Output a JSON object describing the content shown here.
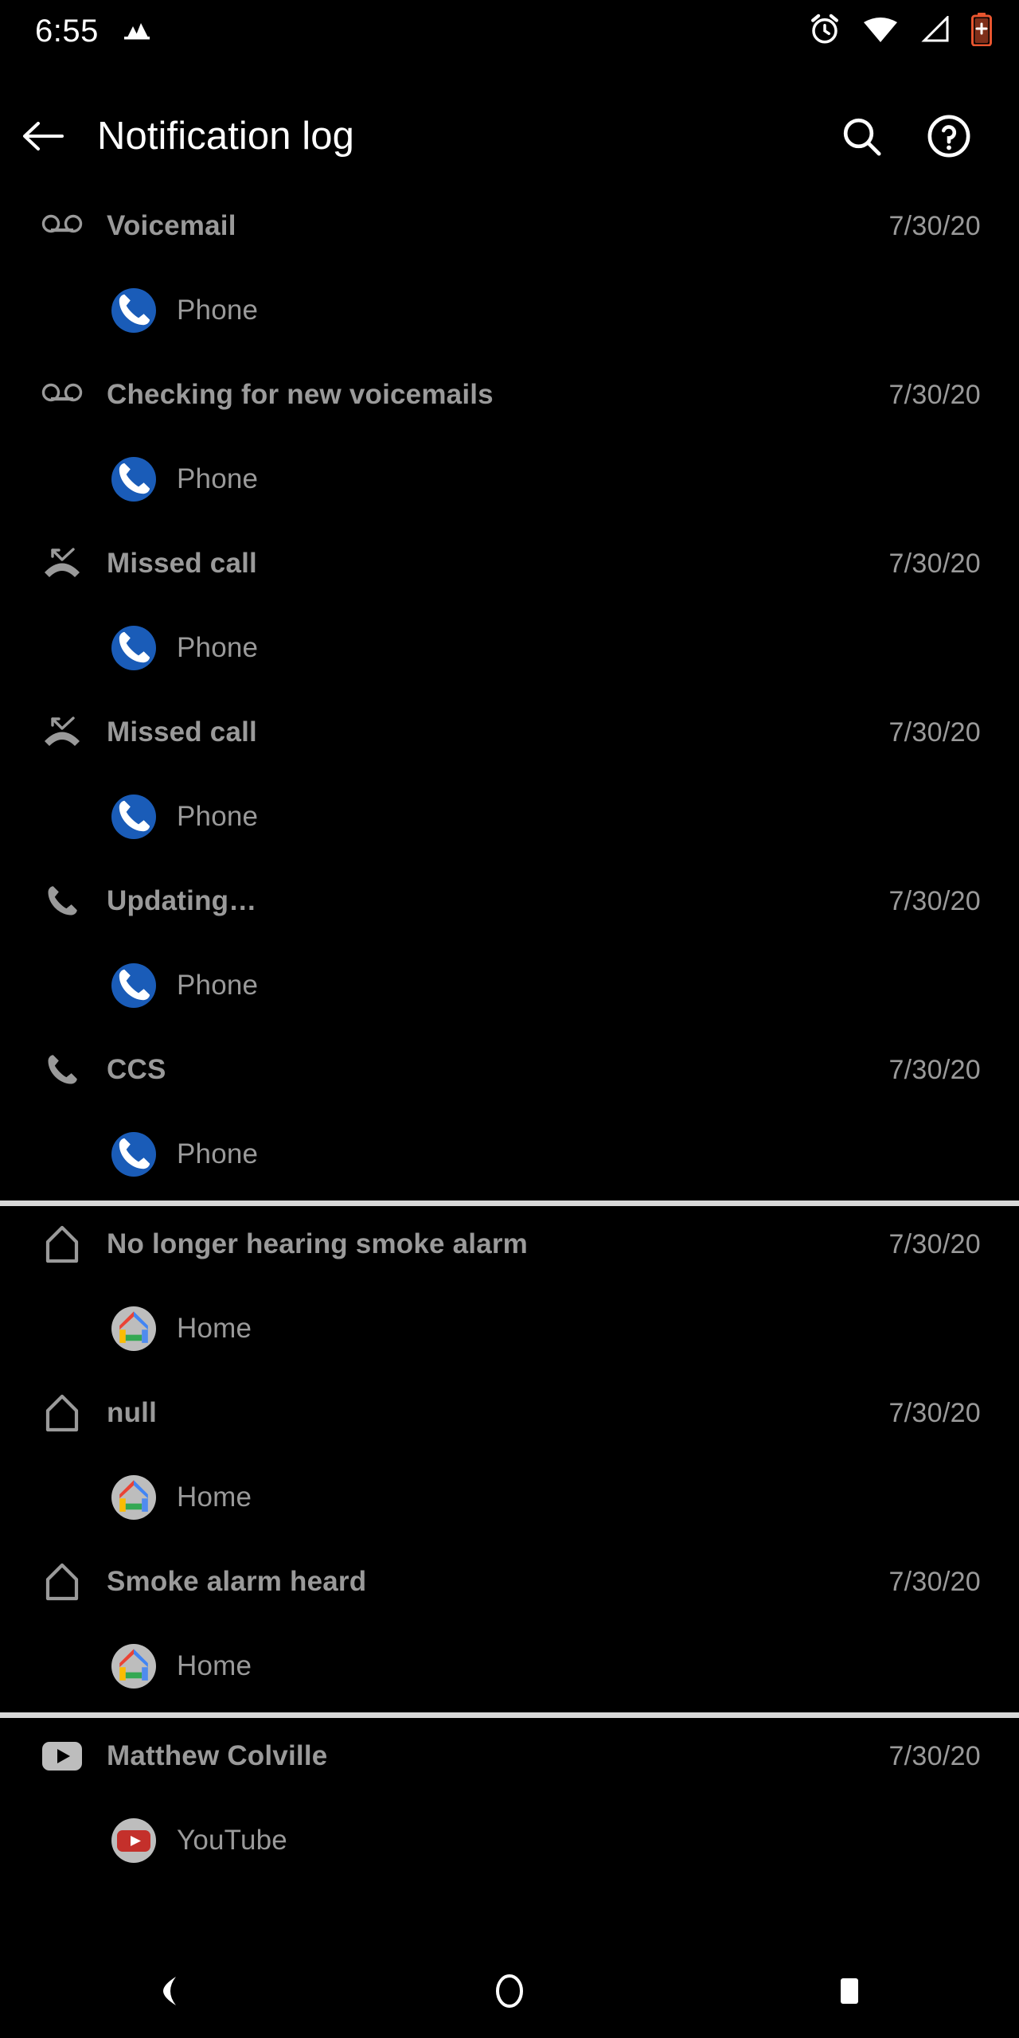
{
  "status_bar": {
    "time": "6:55",
    "left_icons": [
      "image-notification-icon"
    ],
    "right_icons": [
      "alarm-icon",
      "wifi-full-icon",
      "cellular-no-signal-icon",
      "battery-saver-icon"
    ],
    "battery_color": "#e8552f"
  },
  "app_bar": {
    "back_label": "Back",
    "title": "Notification log",
    "search_label": "Search",
    "help_label": "Help"
  },
  "colors": {
    "background": "#000000",
    "primary_text": "#ffffff",
    "secondary_text": "#9a9a9a",
    "divider": "#d8d8d8",
    "phone_blue": "#1a5cb8",
    "youtube_red": "#c4302b",
    "home_grey": "#bdbdbd",
    "google_red": "#ea4335",
    "google_blue": "#4285f4",
    "google_yellow": "#fbbc04",
    "google_green": "#34a853"
  },
  "groups": [
    {
      "id": "group-phone",
      "entries": [
        {
          "icon": "voicemail-icon",
          "title": "Voicemail",
          "date": "7/30/20",
          "app": "Phone",
          "app_icon": "phone-app-icon"
        },
        {
          "icon": "voicemail-icon",
          "title": "Checking for new voicemails",
          "date": "7/30/20",
          "app": "Phone",
          "app_icon": "phone-app-icon"
        },
        {
          "icon": "missed-call-icon",
          "title": "Missed call",
          "date": "7/30/20",
          "app": "Phone",
          "app_icon": "phone-app-icon"
        },
        {
          "icon": "missed-call-icon",
          "title": "Missed call",
          "date": "7/30/20",
          "app": "Phone",
          "app_icon": "phone-app-icon"
        },
        {
          "icon": "phone-call-icon",
          "title": "Updating…",
          "date": "7/30/20",
          "app": "Phone",
          "app_icon": "phone-app-icon"
        },
        {
          "icon": "phone-call-icon",
          "title": "CCS",
          "date": "7/30/20",
          "app": "Phone",
          "app_icon": "phone-app-icon"
        }
      ]
    },
    {
      "id": "group-home",
      "entries": [
        {
          "icon": "home-outline-icon",
          "title": "No longer hearing smoke alarm",
          "date": "7/30/20",
          "app": "Home",
          "app_icon": "google-home-app-icon"
        },
        {
          "icon": "home-outline-icon",
          "title": "null",
          "date": "7/30/20",
          "app": "Home",
          "app_icon": "google-home-app-icon"
        },
        {
          "icon": "home-outline-icon",
          "title": "Smoke alarm heard",
          "date": "7/30/20",
          "app": "Home",
          "app_icon": "google-home-app-icon"
        }
      ]
    },
    {
      "id": "group-youtube",
      "entries": [
        {
          "icon": "youtube-play-icon",
          "title": "Matthew Colville",
          "date": "7/30/20",
          "app": "YouTube",
          "app_icon": "youtube-app-icon"
        }
      ]
    }
  ],
  "nav_bar": {
    "back_label": "Back",
    "home_label": "Home",
    "recents_label": "Recents"
  }
}
